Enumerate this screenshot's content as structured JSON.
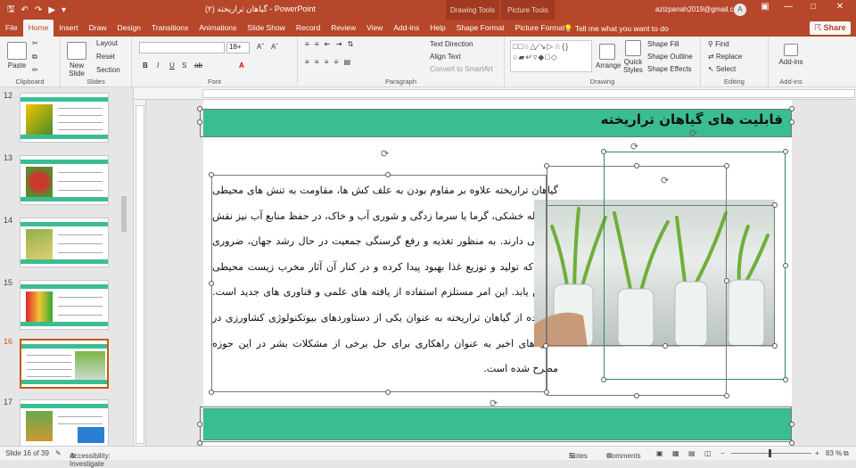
{
  "window": {
    "title": "گیاهان تراریخته (۲) - PowerPoint",
    "context_tabs": [
      "Drawing Tools",
      "Picture Tools"
    ],
    "user_email": "azizpanah2019@gmail.com",
    "avatar_letter": "A"
  },
  "tabs": [
    "File",
    "Home",
    "Insert",
    "Draw",
    "Design",
    "Transitions",
    "Animations",
    "Slide Show",
    "Record",
    "Review",
    "View",
    "Add-ins",
    "Help",
    "Shape Format",
    "Picture Format"
  ],
  "tell_me": "Tell me what you want to do",
  "share_label": "Share",
  "ribbon": {
    "clipboard": {
      "label": "Clipboard",
      "paste": "Paste"
    },
    "slides": {
      "label": "Slides",
      "new_slide": "New Slide",
      "layout": "Layout",
      "reset": "Reset",
      "section": "Section"
    },
    "font": {
      "label": "Font",
      "size": "18+",
      "buttons": [
        "B",
        "I",
        "U",
        "S",
        "ab"
      ]
    },
    "paragraph": {
      "label": "Paragraph",
      "text_direction": "Text Direction",
      "align_text": "Align Text",
      "convert_smartart": "Convert to SmartArt"
    },
    "drawing": {
      "label": "Drawing",
      "arrange": "Arrange",
      "quick_styles": "Quick Styles",
      "shape_fill": "Shape Fill",
      "shape_outline": "Shape Outline",
      "shape_effects": "Shape Effects"
    },
    "editing": {
      "label": "Editing",
      "find": "Find",
      "replace": "Replace",
      "select": "Select"
    },
    "addins": {
      "label": "Add-ins",
      "addins": "Add-ins"
    }
  },
  "slides": [
    {
      "number": "12"
    },
    {
      "number": "13"
    },
    {
      "number": "14"
    },
    {
      "number": "15"
    },
    {
      "number": "16"
    },
    {
      "number": "17"
    }
  ],
  "slide": {
    "title": "قابلیت های گیاهان تراریخته",
    "body": "گیاهان تراریخته علاوه بر مقاوم بودن به علف کش ها، مقاومت به تنش های محیطی از جمله خشکی، گرما یا سرما زدگی و شوری آب و خاک، در حفظ منابع آب نیز نقش بسزایی دارند. به منظور تغذیه و رفع گرسنگی جمعیت در حال رشد جهان، ضروری است که تولید و توزیع غذا بهبود پیدا کرده و در کنار آن آثار مخرب زیست محیطی کاهش یابد. این امر مستلزم استفاده از یافته های علمی و فناوری های جدید است. استفاده از گیاهان تراریخته به عنوان یکی از دستاوردهای بیوتکنولوژی کشاورزی در سال های اخیر به عنوان راهکاری برای حل برخی از مشکلات بشر در این حوزه مطرح  شده است."
  },
  "status": {
    "slide_of": "Slide 16 of 39",
    "accessibility": "Accessibility: Investigate",
    "notes": "Notes",
    "comments": "Comments",
    "zoom": "83 %"
  },
  "colors": {
    "accent": "#b7472a",
    "slide_band": "#3bbd94"
  }
}
